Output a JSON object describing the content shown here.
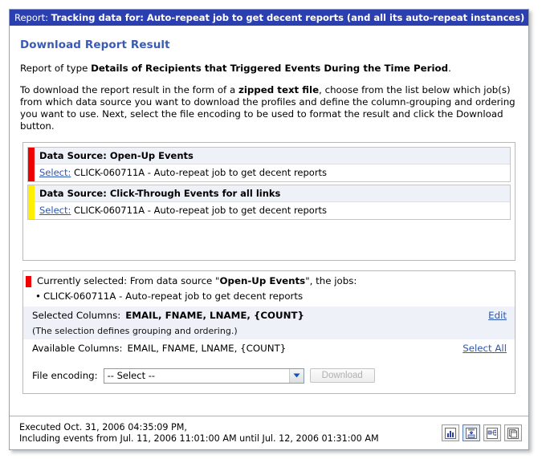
{
  "window": {
    "title_prefix": "Report:",
    "title_main": "Tracking data for: Auto-repeat job to get decent reports (and all its auto-repeat instances)"
  },
  "page": {
    "heading": "Download Report Result",
    "report_type_prefix": "Report of type ",
    "report_type_name": "Details of Recipients that Triggered Events During the Time Period",
    "report_type_suffix": ".",
    "instructions_part1": "To download the report result in the form of a ",
    "instructions_bold": "zipped text file",
    "instructions_part2": ", choose from the list below which job(s) from which data source you want to download the profiles and define the column-grouping and ordering you want to use. Next, select the file encoding to be used to format the result and click the Download button."
  },
  "data_sources": [
    {
      "accent_color": "#ee0000",
      "header": "Data Source: Open-Up Events",
      "select_link": "Select:",
      "job": "CLICK-060711A - Auto-repeat job to get decent reports"
    },
    {
      "accent_color": "#ffef00",
      "header": "Data Source: Click-Through Events for all links",
      "select_link": "Select:",
      "job": "CLICK-060711A - Auto-repeat job to get decent reports"
    }
  ],
  "selection": {
    "accent_color": "#ee0000",
    "summary_prefix": "Currently selected: From data source \"",
    "summary_source": "Open-Up Events",
    "summary_suffix": "\", the jobs:",
    "job_bullet": "CLICK-060711A - Auto-repeat job to get decent reports",
    "selected_columns_label": "Selected Columns:",
    "selected_columns_value": "EMAIL, FNAME, LNAME, {COUNT}",
    "edit_link": "Edit",
    "note": "(The selection defines grouping and ordering.)",
    "available_columns_label": "Available Columns:",
    "available_columns_value": "EMAIL, FNAME, LNAME, {COUNT}",
    "select_all_link": "Select All"
  },
  "encoding": {
    "label": "File encoding:",
    "selected_option": "-- Select --",
    "options": [
      "-- Select --"
    ],
    "download_button": "Download"
  },
  "footer": {
    "executed_line": "Executed Oct. 31, 2006 04:35:09 PM,",
    "events_line": "Including events from Jul. 11, 2006 11:01:00 AM until Jul. 12, 2006 01:31:00 AM",
    "icons": [
      {
        "name": "bar-chart-icon",
        "title": "Chart view"
      },
      {
        "name": "save-report-icon",
        "title": "Download report"
      },
      {
        "name": "tree-detail-icon",
        "title": "Detail view"
      },
      {
        "name": "copy-window-icon",
        "title": "New window"
      }
    ]
  }
}
